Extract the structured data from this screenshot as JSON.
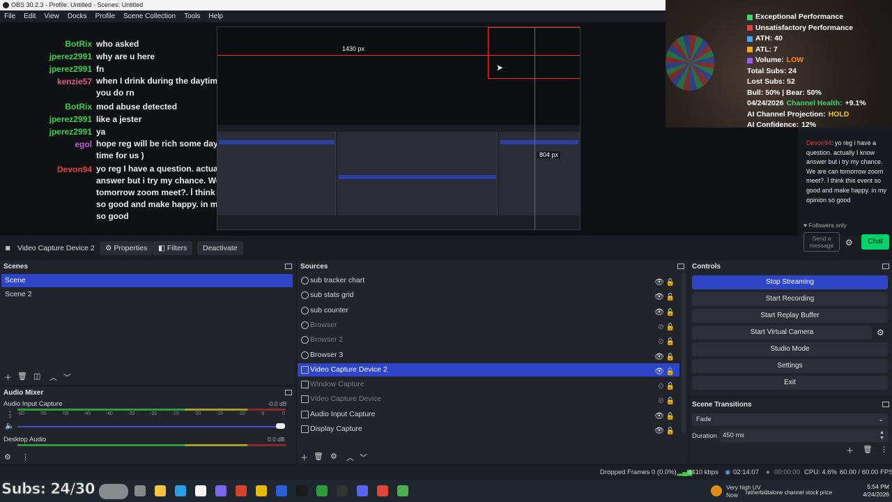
{
  "window": {
    "title": "OBS 30.2.3 - Profile: Untitled - Scenes: Untitled"
  },
  "menu": [
    "File",
    "Edit",
    "View",
    "Docks",
    "Profile",
    "Scene Collection",
    "Tools",
    "Help"
  ],
  "preview": {
    "chat": [
      {
        "user": "BotRix",
        "msg": "who asked",
        "color": "#3bd14a"
      },
      {
        "user": "jperez2991",
        "msg": "why are u here",
        "color": "#3bd14a"
      },
      {
        "user": "jperez2991",
        "msg": "fn",
        "color": "#3bd14a"
      },
      {
        "user": "kenzie57",
        "msg": "when I drink during the daytime I feel how you do rn",
        "color": "#d9607a"
      },
      {
        "user": "BotRix",
        "msg": "mod abuse detected",
        "color": "#3bd14a"
      },
      {
        "user": "jperez2991",
        "msg": "like a jester",
        "color": "#3bd14a"
      },
      {
        "user": "jperez2991",
        "msg": "ya",
        "color": "#3bd14a"
      },
      {
        "user": "egol",
        "msg": "hope reg will be rich some day and has no time for us )",
        "color": "#c05ad6"
      },
      {
        "user": "Devon94",
        "msg": "yo reg I have a question. actually I know answer but i try my chance. We are can tomorrow zoom meet?. İ think this event so good and make happy. in my opinion so good",
        "color": "#e0453a"
      }
    ],
    "dim_labels": {
      "width": "1430 px",
      "height": "804 px"
    },
    "stats": [
      {
        "label": "Exceptional Performance",
        "color": "#3ad86a"
      },
      {
        "label": "Unsatisfactory Performance",
        "color": "#e24242"
      },
      {
        "label": "ATH: 40",
        "color": "#42a6f5"
      },
      {
        "label": "ATL: 7",
        "color": "#f5a623"
      },
      {
        "label": "Volume:",
        "value": "LOW",
        "color": "#9b59f5",
        "value_color": "#ff8c1a"
      }
    ],
    "stats_plain": [
      "Total Subs: 24",
      "Lost Subs: 52",
      "Bull: 50% | Bear: 50%"
    ],
    "health": {
      "date": "04/24/2026",
      "label": "Channel Health:",
      "value": "+9.1%"
    },
    "projection": {
      "label": "AI Channel Projection:",
      "value": "HOLD"
    },
    "confidence": {
      "label": "AI Confidence:",
      "value": "12%"
    },
    "side_chat": {
      "user": "Devon94",
      "text": "yo reg i have a question. actually I know answer but i try my chance. We are can tomorrow zoom meet?. İ think this event so good and make happy. in my opinion so good"
    },
    "followers_only": "Followers only",
    "chat_placeholder": "Send a message",
    "chat_button": "Chat"
  },
  "context_bar": {
    "source": "Video Capture Device 2",
    "properties": "Properties",
    "filters": "Filters",
    "deactivate": "Deactivate"
  },
  "scenes": {
    "title": "Scenes",
    "items": [
      "Scene",
      "Scene 2"
    ],
    "selected": 0
  },
  "sources": {
    "title": "Sources",
    "items": [
      {
        "name": "sub tracker chart",
        "visible": true,
        "icon": "globe-icon"
      },
      {
        "name": "sub stats grid",
        "visible": true,
        "icon": "globe-icon"
      },
      {
        "name": "sub counter",
        "visible": true,
        "icon": "globe-icon"
      },
      {
        "name": "Browser",
        "visible": false,
        "icon": "globe-icon"
      },
      {
        "name": "Browser 2",
        "visible": false,
        "icon": "globe-icon"
      },
      {
        "name": "Browser 3",
        "visible": true,
        "icon": "globe-icon"
      },
      {
        "name": "Video Capture Device 2",
        "visible": true,
        "icon": "camera-icon"
      },
      {
        "name": "Window Capture",
        "visible": false,
        "icon": "window-icon"
      },
      {
        "name": "Video Capture Device",
        "visible": false,
        "icon": "camera-icon"
      },
      {
        "name": "Audio Input Capture",
        "visible": true,
        "icon": "microphone-icon"
      },
      {
        "name": "Display Capture",
        "visible": true,
        "icon": "monitor-icon"
      }
    ],
    "selected": 6
  },
  "controls": {
    "title": "Controls",
    "buttons": [
      "Stop Streaming",
      "Start Recording",
      "Start Replay Buffer",
      "Start Virtual Camera",
      "Studio Mode",
      "Settings",
      "Exit"
    ]
  },
  "audio_mixer": {
    "title": "Audio Mixer",
    "channels": [
      {
        "name": "Audio Input Capture",
        "db": "-0.0 dB"
      },
      {
        "name": "Desktop Audio",
        "db": "0.0 dB"
      }
    ],
    "scale": [
      "-60",
      "-55",
      "-50",
      "-45",
      "-40",
      "-35",
      "-30",
      "-25",
      "-20",
      "-15",
      "-10",
      "-5",
      "0"
    ]
  },
  "scene_transitions": {
    "title": "Scene Transitions",
    "transition": "Fade",
    "duration_label": "Duration",
    "duration": "450 ms"
  },
  "status": {
    "dropped": "Dropped Frames 0 (0.0%)",
    "bitrate": "4410 kbps",
    "stream_time": "02:14:07",
    "rec_time": "00:00:00",
    "cpu": "CPU: 4.6%",
    "fps": "60.00 / 60.00 FPS"
  },
  "taskbar": {
    "subs": "Subs: 24/30",
    "weather": {
      "label": "Very high UV",
      "sub": "Now"
    },
    "ticker": "ratherbidtalone channel stock price",
    "time": "5:54 PM",
    "date": "4/24/2026"
  }
}
